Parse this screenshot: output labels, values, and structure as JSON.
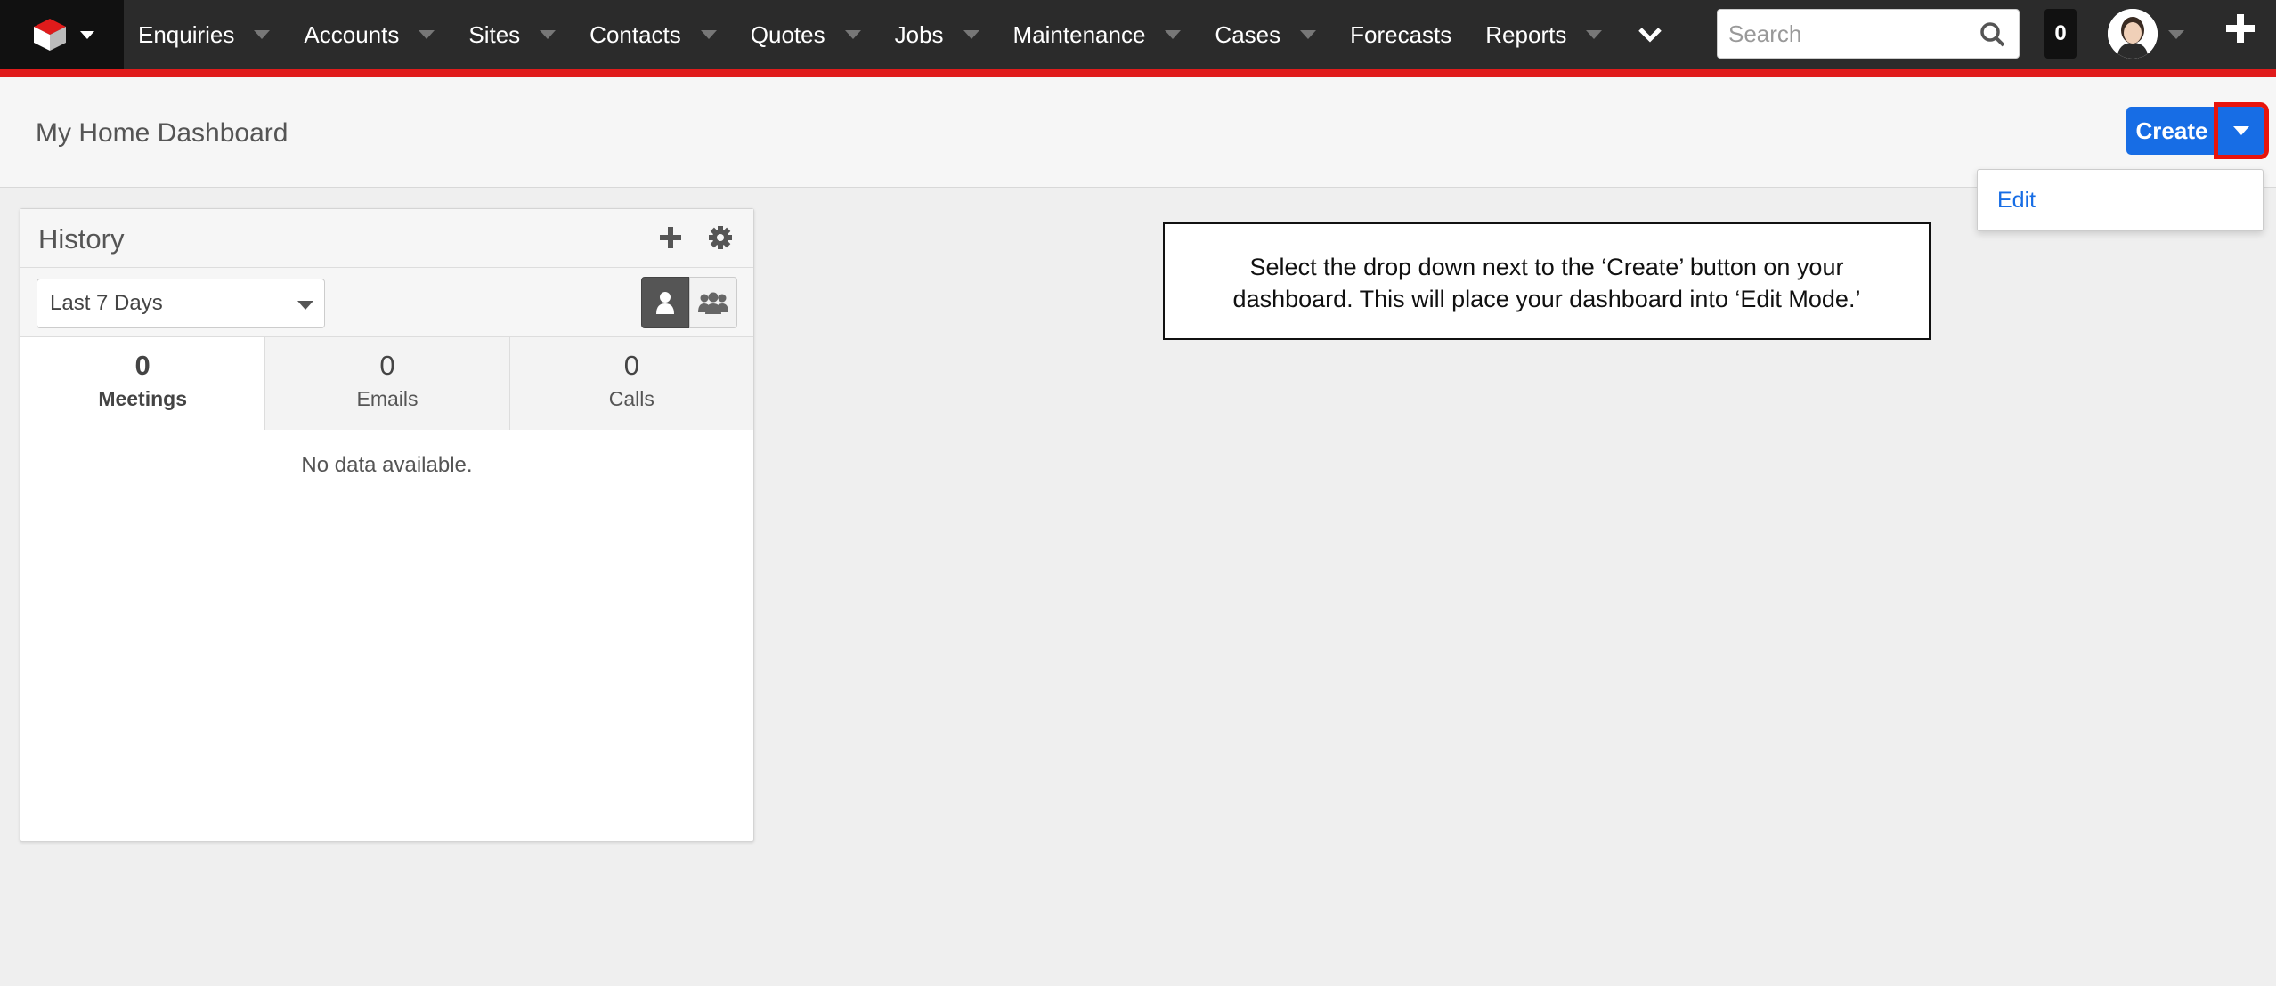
{
  "nav": {
    "items": [
      {
        "label": "Enquiries",
        "has_dropdown": true
      },
      {
        "label": "Accounts",
        "has_dropdown": true
      },
      {
        "label": "Sites",
        "has_dropdown": true
      },
      {
        "label": "Contacts",
        "has_dropdown": true
      },
      {
        "label": "Quotes",
        "has_dropdown": true
      },
      {
        "label": "Jobs",
        "has_dropdown": true
      },
      {
        "label": "Maintenance",
        "has_dropdown": true
      },
      {
        "label": "Cases",
        "has_dropdown": true
      },
      {
        "label": "Forecasts",
        "has_dropdown": false
      },
      {
        "label": "Reports",
        "has_dropdown": true
      }
    ],
    "search_placeholder": "Search",
    "notification_count": "0",
    "icons": [
      "logo-cube-icon",
      "chevron-down-icon",
      "search-icon",
      "avatar",
      "plus-icon"
    ]
  },
  "header": {
    "title": "My Home Dashboard",
    "create_label": "Create",
    "dropdown_item": "Edit"
  },
  "dashlet": {
    "title": "History",
    "range": "Last 7 Days",
    "tabs": [
      {
        "count": "0",
        "label": "Meetings"
      },
      {
        "count": "0",
        "label": "Emails"
      },
      {
        "count": "0",
        "label": "Calls"
      }
    ],
    "empty_text": "No data available."
  },
  "annotation": {
    "text": "Select the drop down next to the ‘Create’ button on your dashboard. This will place your dashboard into ‘Edit Mode.’"
  },
  "colors": {
    "nav_bg": "#2b2b2b",
    "accent_red": "#e01b1b",
    "primary_blue": "#176de5",
    "highlight_box": "#e8140c"
  }
}
